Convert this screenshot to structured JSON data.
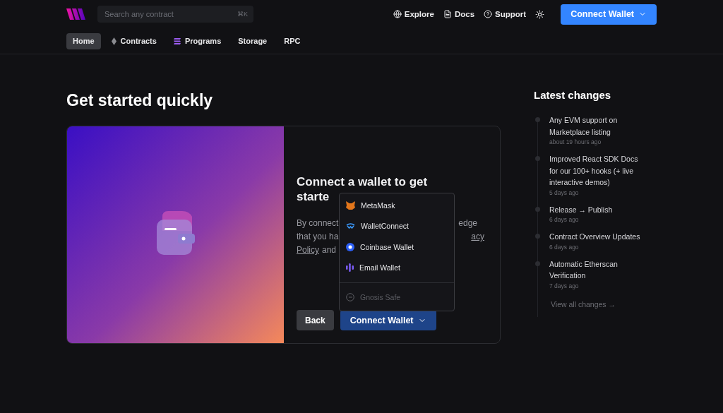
{
  "header": {
    "search": {
      "placeholder": "Search any contract",
      "shortcut": "⌘K"
    },
    "links": [
      {
        "kind": "globe",
        "label": "Explore"
      },
      {
        "kind": "doc",
        "label": "Docs"
      },
      {
        "kind": "help",
        "label": "Support"
      }
    ],
    "connect_button": "Connect Wallet"
  },
  "nav": [
    {
      "kind": "none",
      "label": "Home",
      "selected": true
    },
    {
      "kind": "eth",
      "label": "Contracts",
      "selected": false
    },
    {
      "kind": "sol",
      "label": "Programs",
      "selected": false
    },
    {
      "kind": "none",
      "label": "Storage",
      "selected": false
    },
    {
      "kind": "none",
      "label": "RPC",
      "selected": false
    }
  ],
  "title": "Get started quickly",
  "card": {
    "heading_lines": [
      "Connect a wallet to get",
      "starte"
    ],
    "text_lines": [
      [
        {
          "kind": "text",
          "text": "By connect"
        },
        {
          "kind": "gap"
        },
        {
          "kind": "text",
          "text": "edge"
        }
      ],
      [
        {
          "kind": "text",
          "text": "that you ha"
        },
        {
          "kind": "gap"
        },
        {
          "kind": "link",
          "text": "acy"
        }
      ],
      [
        {
          "kind": "link",
          "text": "Policy"
        },
        {
          "kind": "text",
          "text": "and"
        }
      ]
    ],
    "back": "Back",
    "connect": "Connect Wallet",
    "wallets": [
      {
        "kind": "metamask",
        "label": "MetaMask",
        "disabled": false
      },
      {
        "kind": "walletconnect",
        "label": "WalletConnect",
        "disabled": false
      },
      {
        "kind": "coinbase",
        "label": "Coinbase Wallet",
        "disabled": false
      },
      {
        "kind": "email",
        "label": "Email Wallet",
        "disabled": false
      },
      {
        "kind": "gnosis",
        "label": "Gnosis Safe",
        "disabled": true
      }
    ]
  },
  "changes": {
    "title": "Latest changes",
    "items": [
      {
        "text": "Any EVM support on Marketplace listing",
        "time": "about 19 hours ago"
      },
      {
        "text": "Improved React SDK Docs for our 100+ hooks (+ live interactive demos)",
        "time": "5 days ago"
      },
      {
        "text": "Release → Publish",
        "time": "6 days ago"
      },
      {
        "text": "Contract Overview Updates",
        "time": "6 days ago"
      },
      {
        "text": "Automatic Etherscan Verification",
        "time": "7 days ago"
      }
    ],
    "view_all": "View all changes →"
  }
}
